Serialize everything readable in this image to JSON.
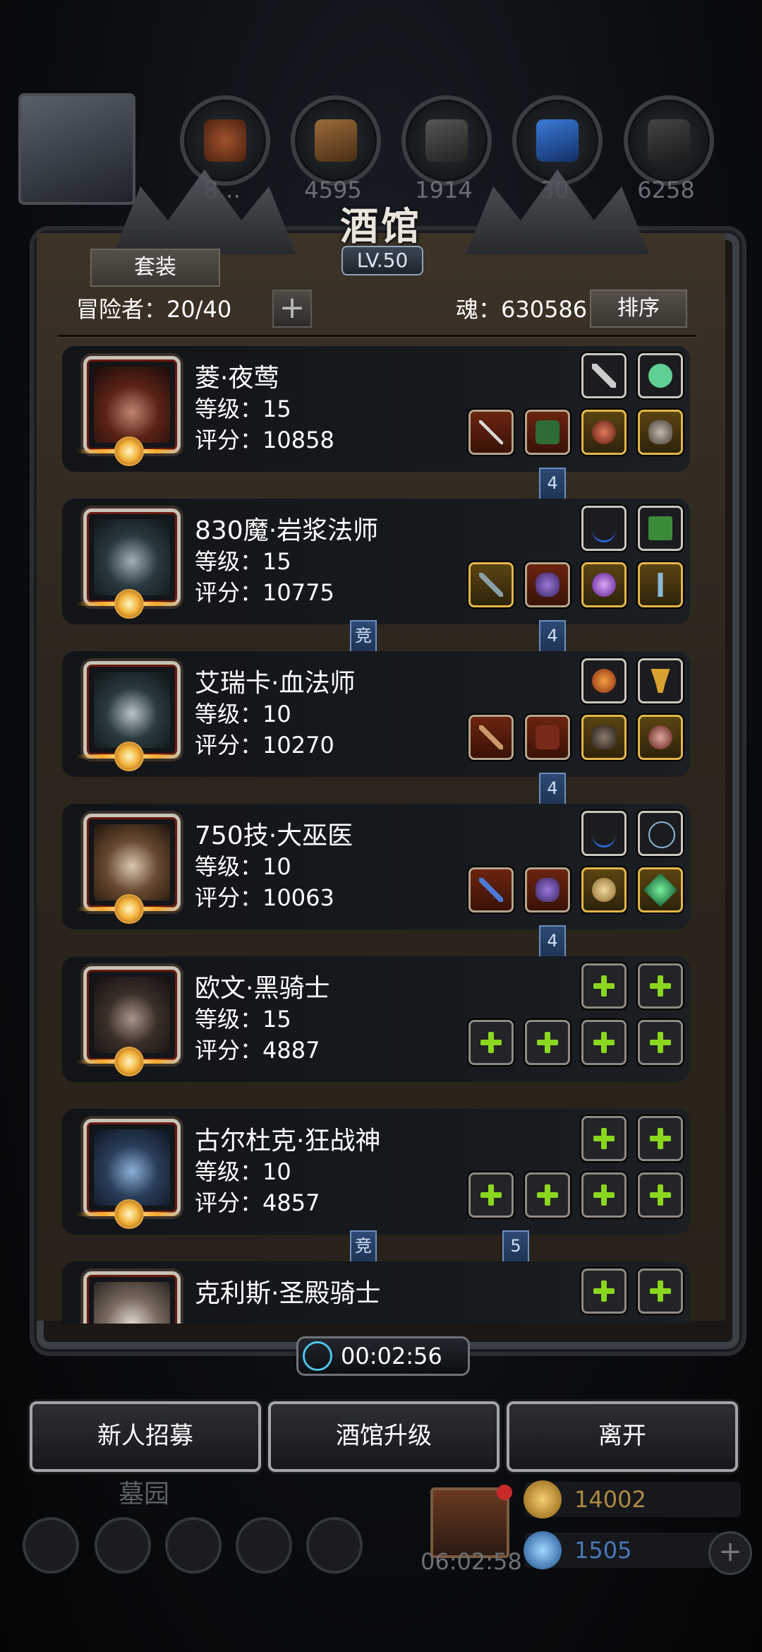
{
  "top_resources": {
    "values": [
      "8…",
      "4595",
      "1914",
      "30",
      "6258"
    ]
  },
  "tavern": {
    "title": "酒馆",
    "level": "LV.50",
    "suit_button": "套装",
    "adventurers_label": "冒险者：20/40",
    "add_label": "+",
    "soul_label": "魂：630586",
    "sort_button": "排序"
  },
  "heroes": [
    {
      "name": "菱·夜莺",
      "level": "等级：15",
      "score": "评分：10858",
      "tags": [
        "4"
      ]
    },
    {
      "name": "830魔·岩浆法师",
      "level": "等级：15",
      "score": "评分：10775",
      "tags": [
        "竞",
        "4"
      ]
    },
    {
      "name": "艾瑞卡·血法师",
      "level": "等级：10",
      "score": "评分：10270",
      "tags": [
        "4"
      ]
    },
    {
      "name": "750技·大巫医",
      "level": "等级：10",
      "score": "评分：10063",
      "tags": [
        "4"
      ]
    },
    {
      "name": "欧文·黑骑士",
      "level": "等级：15",
      "score": "评分：4887",
      "tags": []
    },
    {
      "name": "古尔杜克·狂战神",
      "level": "等级：10",
      "score": "评分：4857",
      "tags": [
        "竞",
        "5"
      ]
    },
    {
      "name": "克利斯·圣殿骑士",
      "level": "",
      "score": "",
      "tags": []
    }
  ],
  "timer": "00:02:56",
  "actions": {
    "recruit": "新人招募",
    "upgrade": "酒馆升级",
    "leave": "离开"
  },
  "hud": {
    "area_label": "墓园",
    "gift_timer": "06:02:58",
    "gold": "14002",
    "gems": "1505",
    "add": "+"
  },
  "colors": {
    "accent_green": "#8bd61f",
    "tag_blue": "#2e4a74",
    "panel_brown": "#3d3327"
  }
}
